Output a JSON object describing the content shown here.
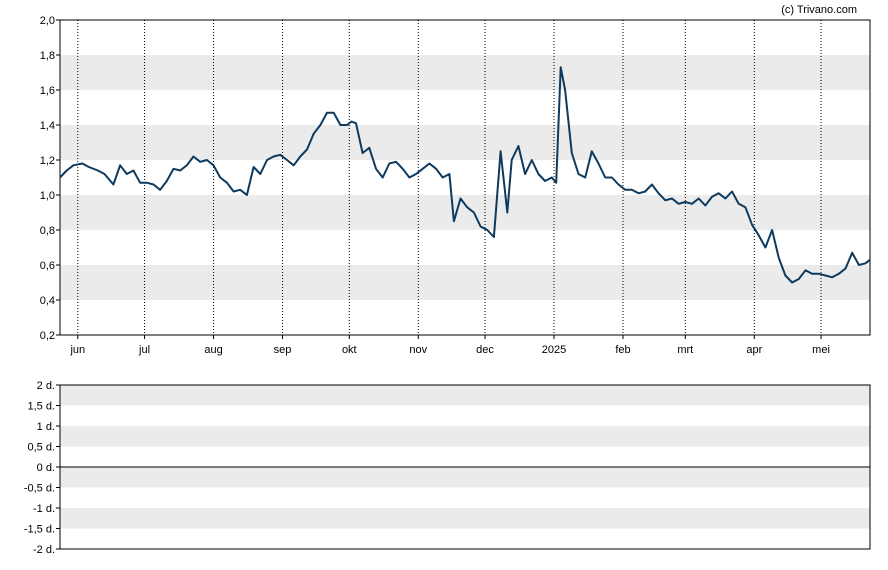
{
  "watermark": "(c) Trivano.com",
  "chart_data": [
    {
      "type": "line",
      "title": "",
      "xlabel": "",
      "ylabel": "",
      "ylim": [
        0.2,
        2.0
      ],
      "y_ticks": [
        "2,0",
        "1,8",
        "1,6",
        "1,4",
        "1,2",
        "1,0",
        "0,8",
        "0,6",
        "0,4",
        "0,2"
      ],
      "y_tick_values": [
        2.0,
        1.8,
        1.6,
        1.4,
        1.2,
        1.0,
        0.8,
        0.6,
        0.4,
        0.2
      ],
      "x_ticks": [
        "jun",
        "jul",
        "aug",
        "sep",
        "okt",
        "nov",
        "dec",
        "2025",
        "feb",
        "mrt",
        "apr",
        "mei"
      ],
      "x_tick_dates": [
        "2024-06-01",
        "2024-07-01",
        "2024-08-01",
        "2024-09-01",
        "2024-10-01",
        "2024-11-01",
        "2024-12-01",
        "2025-01-01",
        "2025-02-01",
        "2025-03-01",
        "2025-04-01",
        "2025-05-01"
      ],
      "xlim": [
        "2024-05-24",
        "2025-05-23"
      ],
      "grid": "alternating horizontal bands, dotted vertical lines",
      "line_color": "#0d3a5e",
      "band_color": "#ebebeb",
      "series": [
        {
          "x": [
            "2024-05-24",
            "2024-05-27",
            "2024-05-30",
            "2024-06-03",
            "2024-06-06",
            "2024-06-10",
            "2024-06-13",
            "2024-06-17",
            "2024-06-20",
            "2024-06-23",
            "2024-06-26",
            "2024-06-29",
            "2024-07-02",
            "2024-07-05",
            "2024-07-08",
            "2024-07-11",
            "2024-07-14",
            "2024-07-17",
            "2024-07-20",
            "2024-07-23",
            "2024-07-26",
            "2024-07-29",
            "2024-08-01",
            "2024-08-04",
            "2024-08-07",
            "2024-08-10",
            "2024-08-13",
            "2024-08-16",
            "2024-08-19",
            "2024-08-22",
            "2024-08-25",
            "2024-08-28",
            "2024-08-31",
            "2024-09-03",
            "2024-09-06",
            "2024-09-09",
            "2024-09-12",
            "2024-09-15",
            "2024-09-18",
            "2024-09-21",
            "2024-09-24",
            "2024-09-27",
            "2024-09-30",
            "2024-10-02",
            "2024-10-04",
            "2024-10-07",
            "2024-10-10",
            "2024-10-13",
            "2024-10-16",
            "2024-10-19",
            "2024-10-22",
            "2024-10-25",
            "2024-10-28",
            "2024-10-31",
            "2024-11-03",
            "2024-11-06",
            "2024-11-09",
            "2024-11-12",
            "2024-11-15",
            "2024-11-17",
            "2024-11-20",
            "2024-11-23",
            "2024-11-26",
            "2024-11-29",
            "2024-12-02",
            "2024-12-05",
            "2024-12-08",
            "2024-12-11",
            "2024-12-13",
            "2024-12-16",
            "2024-12-19",
            "2024-12-22",
            "2024-12-25",
            "2024-12-28",
            "2024-12-31",
            "2025-01-02",
            "2025-01-04",
            "2025-01-06",
            "2025-01-09",
            "2025-01-12",
            "2025-01-15",
            "2025-01-18",
            "2025-01-21",
            "2025-01-24",
            "2025-01-27",
            "2025-01-30",
            "2025-02-02",
            "2025-02-05",
            "2025-02-08",
            "2025-02-11",
            "2025-02-14",
            "2025-02-17",
            "2025-02-20",
            "2025-02-23",
            "2025-02-26",
            "2025-03-01",
            "2025-03-04",
            "2025-03-07",
            "2025-03-10",
            "2025-03-13",
            "2025-03-16",
            "2025-03-19",
            "2025-03-22",
            "2025-03-25",
            "2025-03-28",
            "2025-03-31",
            "2025-04-03",
            "2025-04-06",
            "2025-04-09",
            "2025-04-12",
            "2025-04-15",
            "2025-04-18",
            "2025-04-21",
            "2025-04-24",
            "2025-04-27",
            "2025-04-30",
            "2025-05-03",
            "2025-05-06",
            "2025-05-09",
            "2025-05-12",
            "2025-05-15",
            "2025-05-18",
            "2025-05-21",
            "2025-05-23"
          ],
          "values": [
            1.1,
            1.14,
            1.17,
            1.18,
            1.16,
            1.14,
            1.12,
            1.06,
            1.17,
            1.12,
            1.14,
            1.07,
            1.07,
            1.06,
            1.03,
            1.08,
            1.15,
            1.14,
            1.17,
            1.22,
            1.19,
            1.2,
            1.17,
            1.1,
            1.07,
            1.02,
            1.03,
            1.0,
            1.16,
            1.12,
            1.2,
            1.22,
            1.23,
            1.2,
            1.17,
            1.22,
            1.26,
            1.35,
            1.4,
            1.47,
            1.47,
            1.4,
            1.4,
            1.42,
            1.41,
            1.24,
            1.27,
            1.15,
            1.1,
            1.18,
            1.19,
            1.15,
            1.1,
            1.12,
            1.15,
            1.18,
            1.15,
            1.1,
            1.12,
            0.85,
            0.98,
            0.93,
            0.9,
            0.82,
            0.8,
            0.76,
            1.25,
            0.9,
            1.2,
            1.28,
            1.12,
            1.2,
            1.12,
            1.08,
            1.1,
            1.07,
            1.73,
            1.6,
            1.24,
            1.12,
            1.1,
            1.25,
            1.18,
            1.1,
            1.1,
            1.06,
            1.03,
            1.03,
            1.01,
            1.02,
            1.06,
            1.01,
            0.97,
            0.98,
            0.95,
            0.96,
            0.95,
            0.98,
            0.94,
            0.99,
            1.01,
            0.98,
            1.02,
            0.95,
            0.93,
            0.83,
            0.77,
            0.7,
            0.8,
            0.64,
            0.54,
            0.5,
            0.52,
            0.57,
            0.55,
            0.55,
            0.54,
            0.53,
            0.55,
            0.58,
            0.67,
            0.6,
            0.61,
            0.63
          ]
        }
      ]
    },
    {
      "type": "line",
      "title": "",
      "ylim": [
        -2,
        2
      ],
      "y_ticks": [
        "2 d.",
        "1,5 d.",
        "1 d.",
        "0,5 d.",
        "0 d.",
        "-0,5 d.",
        "-1 d.",
        "-1,5 d.",
        "-2 d."
      ],
      "y_tick_values": [
        2,
        1.5,
        1,
        0.5,
        0,
        -0.5,
        -1,
        -1.5,
        -2
      ],
      "grid": "alternating horizontal bands, zero line",
      "series": []
    }
  ]
}
